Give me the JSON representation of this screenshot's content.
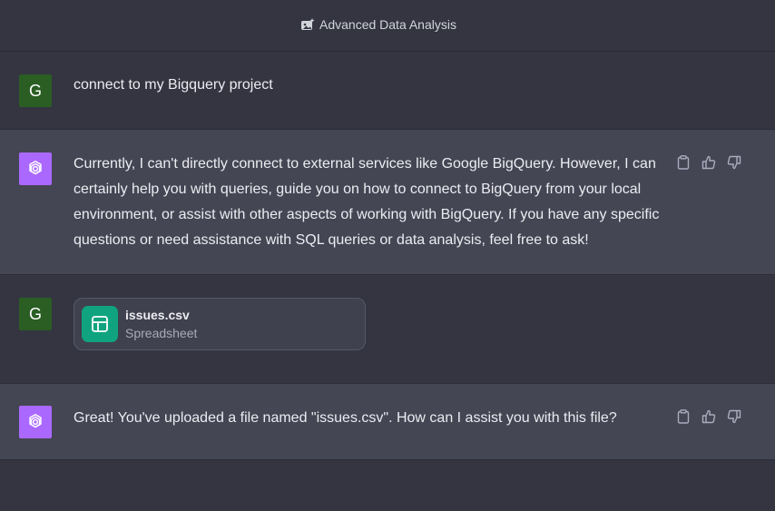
{
  "header": {
    "title": "Advanced Data Analysis",
    "icon": "sparkle-image-icon"
  },
  "messages": [
    {
      "role": "user",
      "avatar_letter": "G",
      "text": "connect to my Bigquery project"
    },
    {
      "role": "assistant",
      "text": "Currently, I can't directly connect to external services like Google BigQuery. However, I can certainly help you with queries, guide you on how to connect to BigQuery from your local environment, or assist with other aspects of working with BigQuery. If you have any specific questions or need assistance with SQL queries or data analysis, feel free to ask!"
    },
    {
      "role": "user",
      "avatar_letter": "G",
      "attachment": {
        "name": "issues.csv",
        "type": "Spreadsheet"
      }
    },
    {
      "role": "assistant",
      "text": "Great! You've uploaded a file named \"issues.csv\". How can I assist you with this file?"
    }
  ],
  "colors": {
    "background": "#343541",
    "assistant_row": "#444654",
    "user_avatar": "#2a5e23",
    "assistant_avatar": "#ab68ff",
    "file_icon": "#10a37f"
  }
}
